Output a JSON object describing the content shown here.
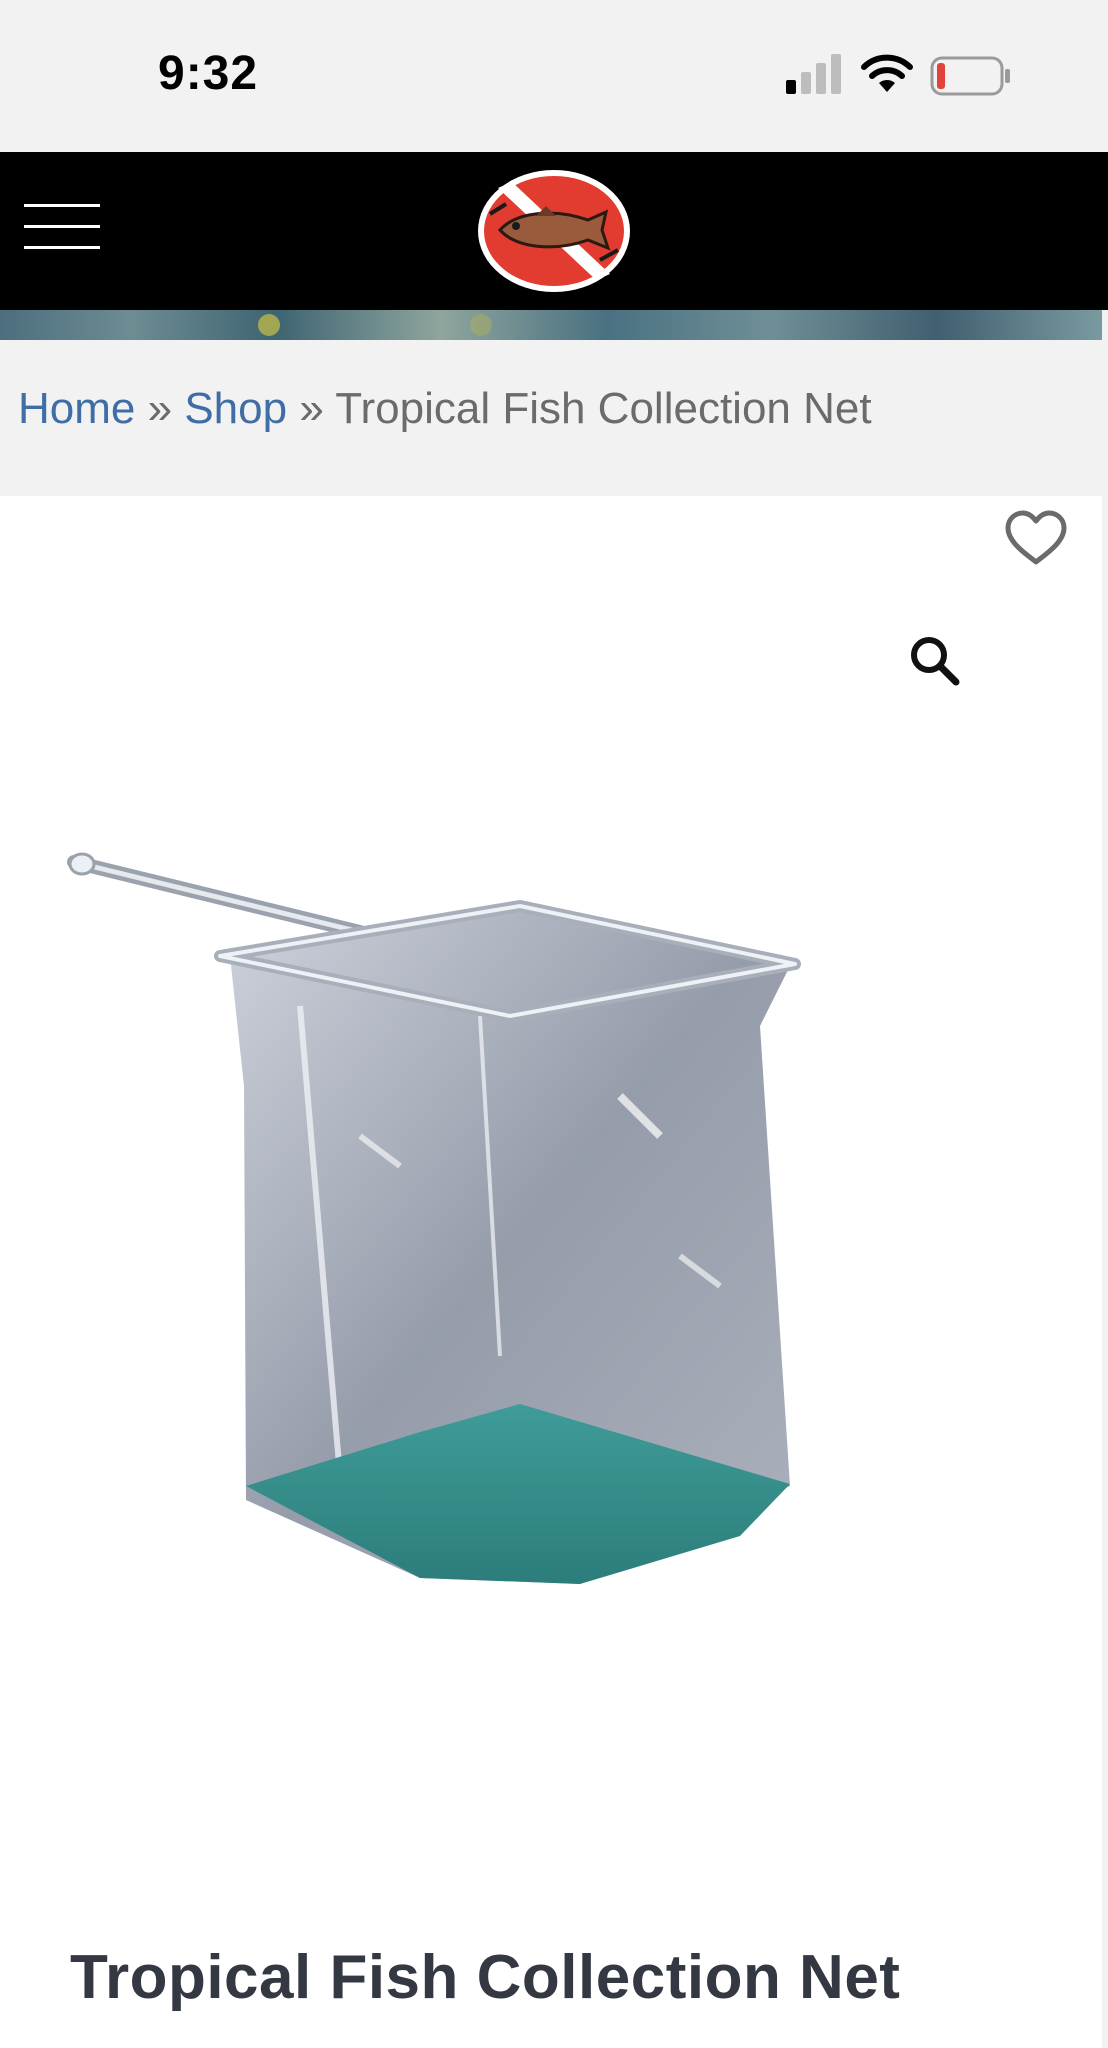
{
  "status_bar": {
    "time": "9:32",
    "icons": [
      "signal-icon",
      "wifi-icon",
      "battery-icon"
    ],
    "battery_color": "#e0433a"
  },
  "header": {
    "menu_icon": "hamburger-menu-icon",
    "logo": "dive-flag-fish-logo",
    "background": "#000000"
  },
  "breadcrumb": {
    "items": [
      {
        "label": "Home",
        "link": true
      },
      {
        "label": "Shop",
        "link": true
      },
      {
        "label": "Tropical Fish Collection Net",
        "link": false
      }
    ],
    "separator": "»",
    "link_color": "#3f6ea6"
  },
  "product": {
    "wishlist_icon": "heart-outline-icon",
    "zoom_icon": "magnifier-icon",
    "title": "Tropical Fish Collection Net"
  }
}
